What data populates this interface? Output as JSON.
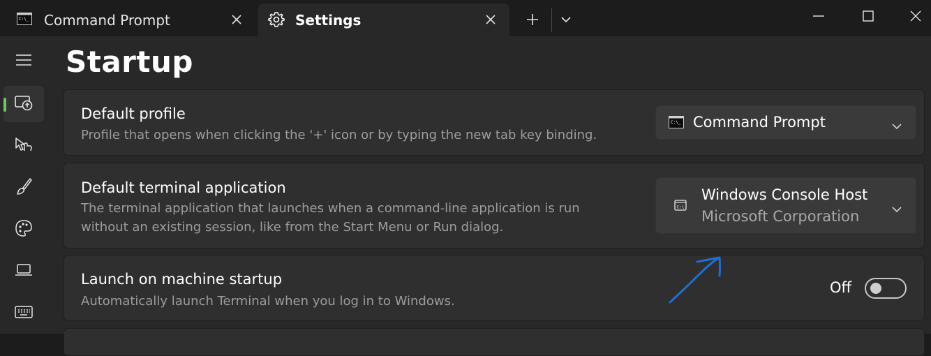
{
  "tabs": [
    {
      "label": "Command Prompt",
      "icon": "terminal-icon"
    },
    {
      "label": "Settings",
      "icon": "gear-icon",
      "active": true
    }
  ],
  "titlebar_buttons": [
    "new-tab-icon",
    "dropdown-chevron-icon",
    "minimize-icon",
    "maximize-icon",
    "close-icon"
  ],
  "sidebar": {
    "items": [
      {
        "icon": "hamburger-menu-icon"
      },
      {
        "icon": "startup-icon",
        "selected": true
      },
      {
        "icon": "interaction-icon"
      },
      {
        "icon": "appearance-brush-icon"
      },
      {
        "icon": "color-palette-icon"
      },
      {
        "icon": "rendering-laptop-icon"
      },
      {
        "icon": "keyboard-icon"
      }
    ],
    "accent_color": "#6ccb5f"
  },
  "page": {
    "title": "Startup"
  },
  "settings": {
    "default_profile": {
      "title": "Default profile",
      "description": "Profile that opens when clicking the '+' icon or by typing the new tab key binding.",
      "value": "Command Prompt"
    },
    "default_terminal": {
      "title": "Default terminal application",
      "description_line1": "The terminal application that launches when a command-line application is run",
      "description_line2": "without an existing session, like from the Start Menu or Run dialog.",
      "value": "Windows Console Host",
      "value_sub": "Microsoft Corporation"
    },
    "launch_on_startup": {
      "title": "Launch on machine startup",
      "description": "Automatically launch Terminal when you log in to Windows.",
      "state_label": "Off",
      "enabled": false
    }
  },
  "annotation": {
    "type": "arrow",
    "color": "#1f6fd6"
  }
}
